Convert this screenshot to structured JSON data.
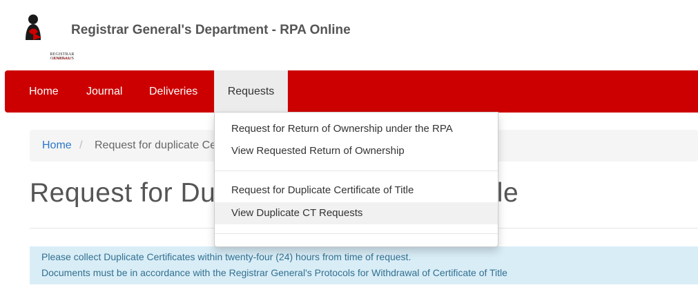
{
  "header": {
    "site_title": "Registrar General's Department - RPA Online",
    "logo_text": "REGISTRAR GENERAL'S",
    "logo_subtext": "DEPARTMENT"
  },
  "nav": {
    "items": [
      {
        "label": "Home"
      },
      {
        "label": "Journal"
      },
      {
        "label": "Deliveries"
      },
      {
        "label": "Requests"
      }
    ],
    "active": "Requests"
  },
  "breadcrumb": {
    "home": "Home",
    "separator": "/",
    "current": "Request for duplicate Certificate of Title"
  },
  "page_title": "Request for Duplicate Certificate of Title",
  "dropdown": {
    "items": [
      {
        "label": "Request for Return of Ownership under the RPA"
      },
      {
        "label": "View Requested Return of Ownership"
      },
      {
        "label": "Request for Duplicate Certificate of Title"
      },
      {
        "label": "View Duplicate CT Requests"
      }
    ],
    "hovered": "View Duplicate CT Requests"
  },
  "alert": {
    "line1": "Please collect Duplicate Certificates within twenty-four (24) hours from time of request.",
    "line2": "Documents must be in accordance with the Registrar General's Protocols for Withdrawal of Certificate of Title"
  },
  "colors": {
    "nav_bg": "#cc0000",
    "link": "#2a77c9",
    "alert_bg": "#d9edf7",
    "alert_text": "#31708f"
  }
}
